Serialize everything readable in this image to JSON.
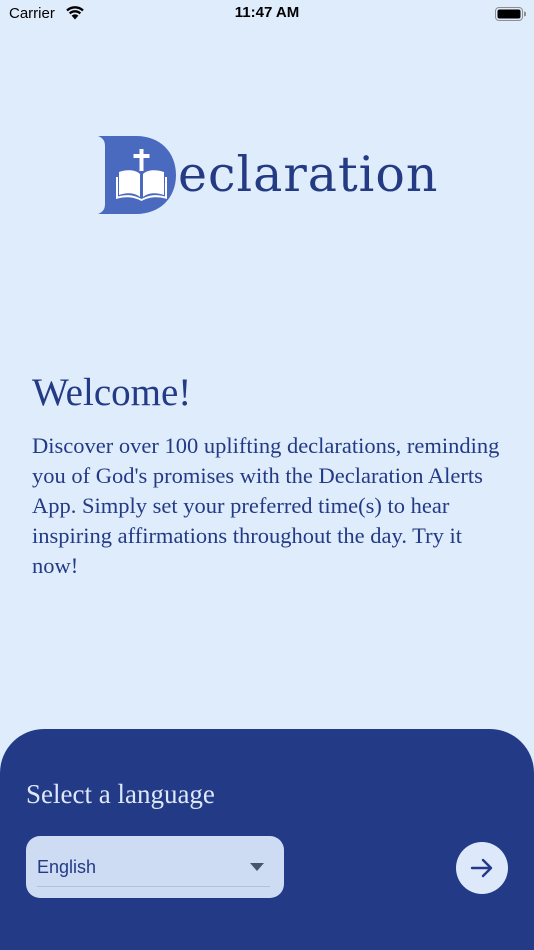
{
  "status_bar": {
    "carrier": "Carrier",
    "time": "11:47 AM"
  },
  "logo": {
    "text": "eclaration",
    "icon": "bible-cross-icon"
  },
  "welcome": {
    "title": "Welcome!",
    "body": "Discover over 100 uplifting declarations, reminding you of God's promises with the Declaration Alerts App. Simply set your preferred time(s) to hear inspiring affirmations throughout the day. Try it now!"
  },
  "language_sheet": {
    "title": "Select a language",
    "selected_language": "English",
    "dropdown_icon": "chevron-down-icon",
    "next_icon": "arrow-right-icon"
  },
  "colors": {
    "background": "#dfecfc",
    "brand_navy": "#233a87",
    "logo_blue": "#4a6abf",
    "sheet_text": "#dde9fa",
    "select_fill": "#cddcf3"
  }
}
